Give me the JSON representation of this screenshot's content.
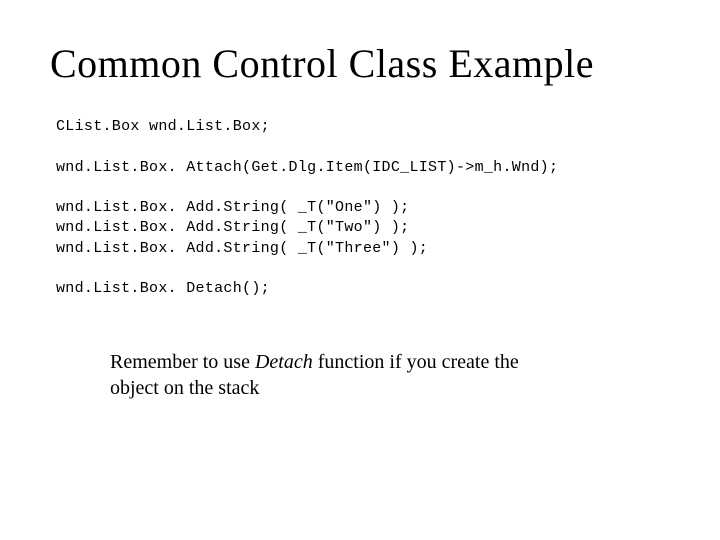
{
  "title": "Common Control Class Example",
  "code": {
    "l1": "CList.Box wnd.List.Box;",
    "l2": "",
    "l3": "wnd.List.Box. Attach(Get.Dlg.Item(IDC_LIST)->m_h.Wnd);",
    "l4": "",
    "l5": "wnd.List.Box. Add.String( _T(\"One\") );",
    "l6": "wnd.List.Box. Add.String( _T(\"Two\") );",
    "l7": "wnd.List.Box. Add.String( _T(\"Three\") );",
    "l8": "",
    "l9": "wnd.List.Box. Detach();"
  },
  "note": {
    "pre": "Remember to use ",
    "italic": "Detach",
    "post": " function if you create the object on the stack"
  }
}
